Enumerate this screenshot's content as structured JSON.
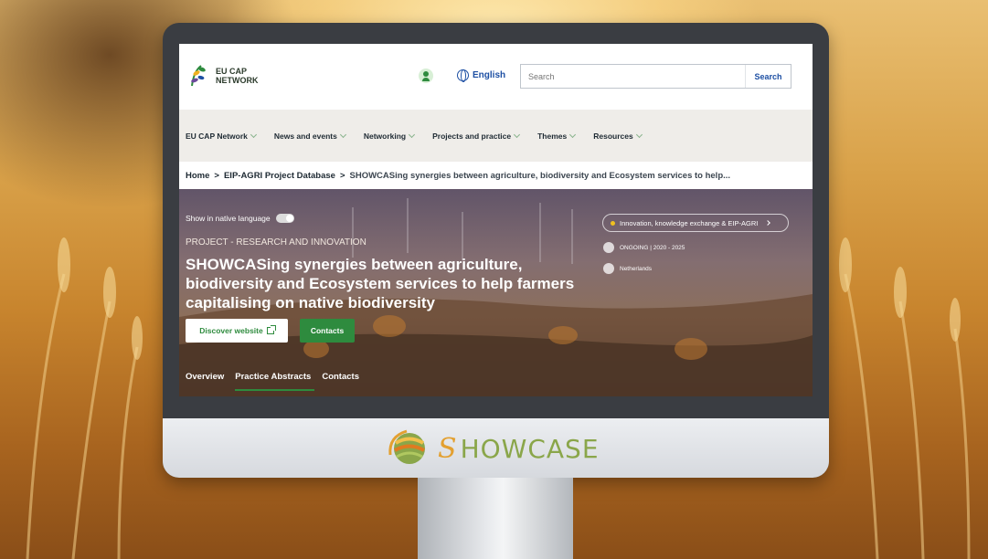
{
  "colors": {
    "accent_green": "#2e8b3e",
    "link_blue": "#1d4fa3",
    "nav_bg": "#efede9",
    "brand_green": "#8aa64a",
    "brand_orange": "#e3a030"
  },
  "header": {
    "logo_line1": "EU CAP",
    "logo_line2": "NETWORK",
    "language": "English",
    "search_placeholder": "Search",
    "search_button": "Search"
  },
  "nav": {
    "items": [
      {
        "label": "EU CAP Network"
      },
      {
        "label": "News and events"
      },
      {
        "label": "Networking"
      },
      {
        "label": "Projects and practice"
      },
      {
        "label": "Themes"
      },
      {
        "label": "Resources"
      }
    ]
  },
  "breadcrumb": {
    "home": "Home",
    "sep": ">",
    "level1": "EIP-AGRI Project Database",
    "current": "SHOWCASing synergies between agriculture, biodiversity and Ecosystem services to help..."
  },
  "hero": {
    "toggle_label": "Show in native language",
    "kicker": "PROJECT - RESEARCH AND INNOVATION",
    "title": "SHOWCASing synergies between agriculture, biodiversity and Ecosystem services to help farmers capitalising on native biodiversity",
    "discover_button": "Discover website",
    "contacts_button": "Contacts",
    "theme_tag": "Innovation, knowledge exchange & EIP-AGRI",
    "status": "ONGOING | 2020 - 2025",
    "country": "Netherlands",
    "tabs": [
      {
        "label": "Overview"
      },
      {
        "label": "Practice Abstracts"
      },
      {
        "label": "Contacts"
      }
    ]
  },
  "brand": {
    "s_letter": "S",
    "rest": "HOWCASE"
  }
}
